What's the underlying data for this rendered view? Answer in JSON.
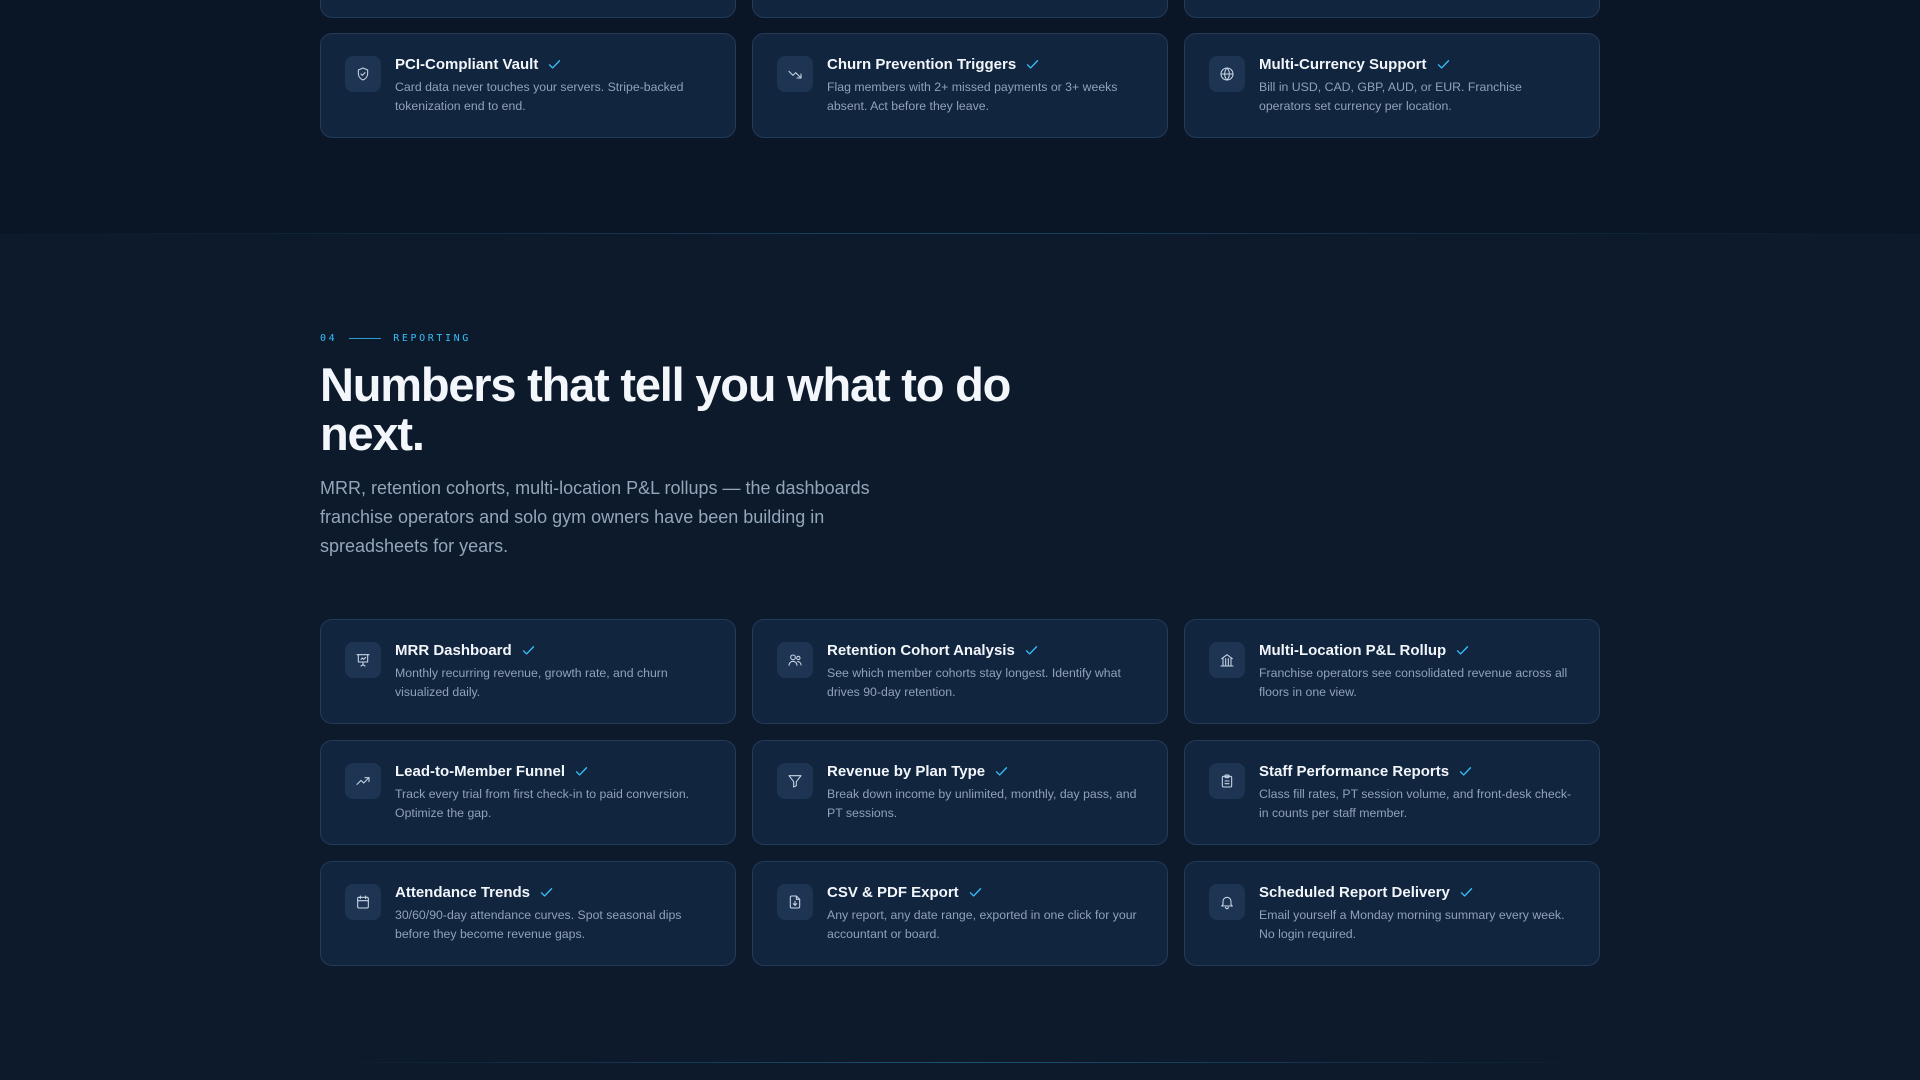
{
  "security": {
    "cards": [
      {
        "title": "PCI-Compliant Vault",
        "description": "Card data never touches your servers. Stripe-backed tokenization end to end.",
        "icon": "shield-check-icon"
      },
      {
        "title": "Churn Prevention Triggers",
        "description": "Flag members with 2+ missed payments or 3+ weeks absent. Act before they leave.",
        "icon": "trending-down-icon"
      },
      {
        "title": "Multi-Currency Support",
        "description": "Bill in USD, CAD, GBP, AUD, or EUR. Franchise operators set currency per location.",
        "icon": "globe-icon"
      }
    ]
  },
  "reporting": {
    "eyebrow_number": "04",
    "eyebrow_label": "REPORTING",
    "headline": "Numbers that tell you what to do next.",
    "lead": "MRR, retention cohorts, multi-location P&L rollups — the dashboards franchise operators and solo gym owners have been building in spreadsheets for years.",
    "cards": [
      {
        "title": "MRR Dashboard",
        "description": "Monthly recurring revenue, growth rate, and churn visualized daily.",
        "icon": "presentation-chart-icon"
      },
      {
        "title": "Retention Cohort Analysis",
        "description": "See which member cohorts stay longest. Identify what drives 90-day retention.",
        "icon": "users-icon"
      },
      {
        "title": "Multi-Location P&L Rollup",
        "description": "Franchise operators see consolidated revenue across all floors in one view.",
        "icon": "building-icon"
      },
      {
        "title": "Lead-to-Member Funnel",
        "description": "Track every trial from first check-in to paid conversion. Optimize the gap.",
        "icon": "trending-up-icon"
      },
      {
        "title": "Revenue by Plan Type",
        "description": "Break down income by unlimited, monthly, day pass, and PT sessions.",
        "icon": "filter-icon"
      },
      {
        "title": "Staff Performance Reports",
        "description": "Class fill rates, PT session volume, and front-desk check-in counts per staff member.",
        "icon": "clipboard-icon"
      },
      {
        "title": "Attendance Trends",
        "description": "30/60/90-day attendance curves. Spot seasonal dips before they become revenue gaps.",
        "icon": "calendar-icon"
      },
      {
        "title": "CSV & PDF Export",
        "description": "Any report, any date range, exported in one click for your accountant or board.",
        "icon": "file-export-icon"
      },
      {
        "title": "Scheduled Report Delivery",
        "description": "Email yourself a Monday morning summary every week. No login required.",
        "icon": "bell-icon"
      }
    ]
  },
  "colors": {
    "accent": "#38bdf8",
    "background": "#0c1a2c",
    "card": "#11253f"
  }
}
